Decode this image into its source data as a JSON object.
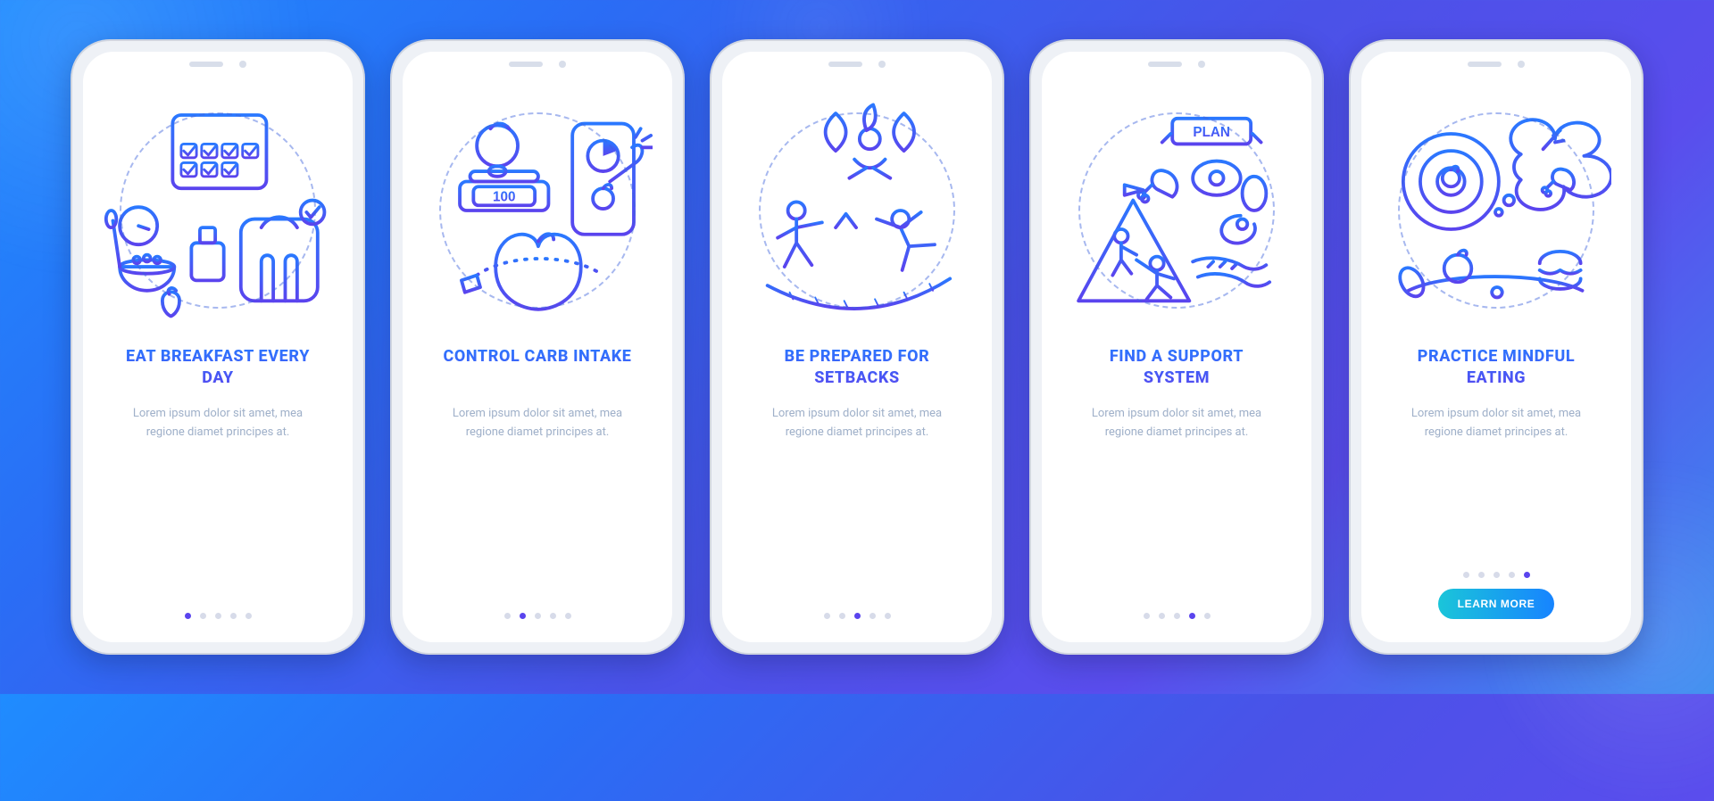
{
  "accent_gradient_from": "#2a78ff",
  "accent_gradient_to": "#5a44ee",
  "cta_gradient_from": "#1ac5d9",
  "cta_gradient_to": "#1784ff",
  "description": "Lorem ipsum dolor sit amet, mea regione diamet principes at.",
  "cta_label": "LEARN MORE",
  "num_slides": 5,
  "illus_label_slide2": "100",
  "illus_label_slide4": "PLAN",
  "slides": [
    {
      "title": "EAT BREAKFAST EVERY DAY",
      "icon": "breakfast-scale-icon",
      "active_index": 0,
      "has_cta": false
    },
    {
      "title": "CONTROL CARB INTAKE",
      "icon": "carb-intake-icon",
      "active_index": 1,
      "has_cta": false
    },
    {
      "title": "BE PREPARED FOR SETBACKS",
      "icon": "setbacks-icon",
      "active_index": 2,
      "has_cta": false
    },
    {
      "title": "FIND A SUPPORT SYSTEM",
      "icon": "support-system-icon",
      "active_index": 3,
      "has_cta": false
    },
    {
      "title": "PRACTICE MINDFUL EATING",
      "icon": "mindful-eating-icon",
      "active_index": 4,
      "has_cta": true
    }
  ]
}
